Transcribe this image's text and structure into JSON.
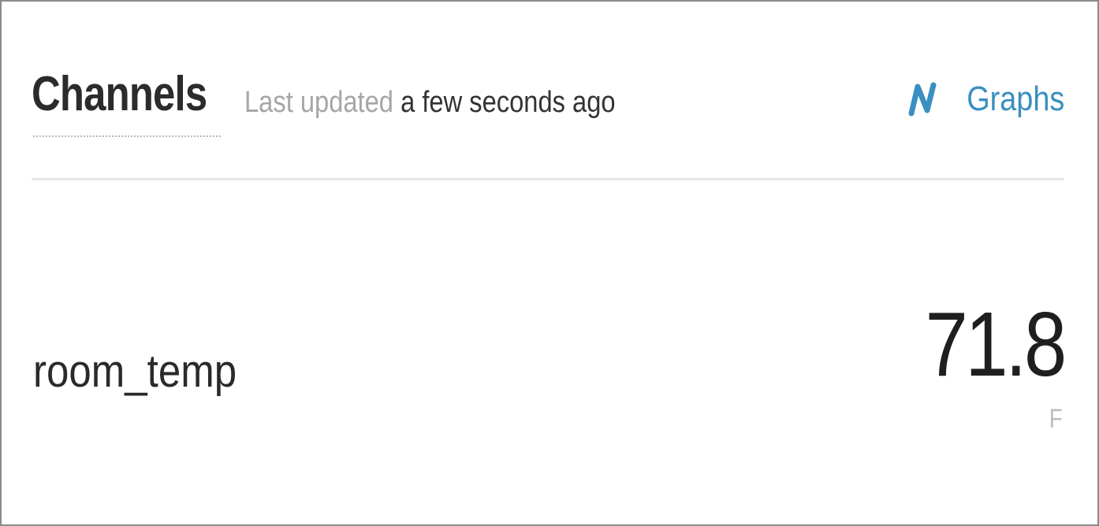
{
  "header": {
    "title": "Channels",
    "last_updated_label": "Last updated",
    "last_updated_value": "a few seconds ago",
    "graphs_link": {
      "label": "Graphs",
      "icon": "line-graph-icon",
      "color": "#3a8fc0"
    }
  },
  "channels": [
    {
      "name": "room_temp",
      "value": "71.8",
      "unit": "F"
    }
  ]
}
